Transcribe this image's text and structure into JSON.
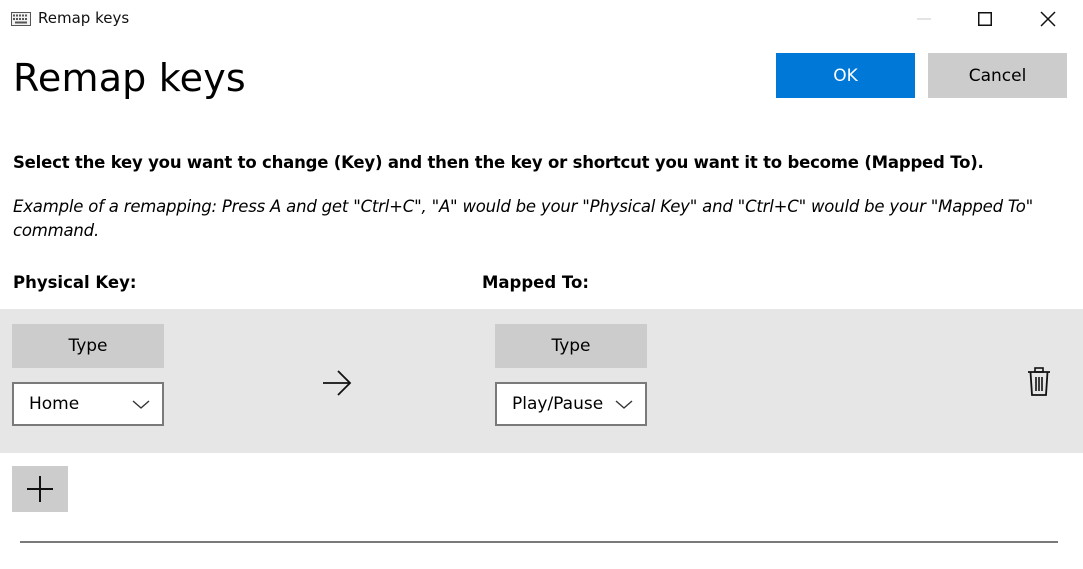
{
  "window": {
    "title": "Remap keys",
    "app_icon": "keyboard-icon",
    "controls": [
      "minimize-icon",
      "maximize-icon",
      "close-icon"
    ]
  },
  "header": {
    "title": "Remap keys",
    "ok_label": "OK",
    "cancel_label": "Cancel"
  },
  "instructions": {
    "main": "Select the key you want to change (Key) and then the key or shortcut you want it to become (Mapped To).",
    "example": "Example of a remapping: Press A and get \"Ctrl+C\", \"A\" would be your \"Physical Key\" and \"Ctrl+C\" would be your \"Mapped To\" command."
  },
  "columns": {
    "physical": "Physical Key:",
    "mapped": "Mapped To:"
  },
  "mappings": [
    {
      "physical_type_label": "Type",
      "physical_key": "Home",
      "mapped_type_label": "Type",
      "mapped_key": "Play/Pause",
      "arrow_icon": "arrow-right-icon",
      "delete_icon": "trash-icon"
    }
  ],
  "add_icon": "plus-icon",
  "colors": {
    "accent": "#0078d7",
    "button_gray": "#cccccc",
    "row_background": "#e6e6e6"
  }
}
